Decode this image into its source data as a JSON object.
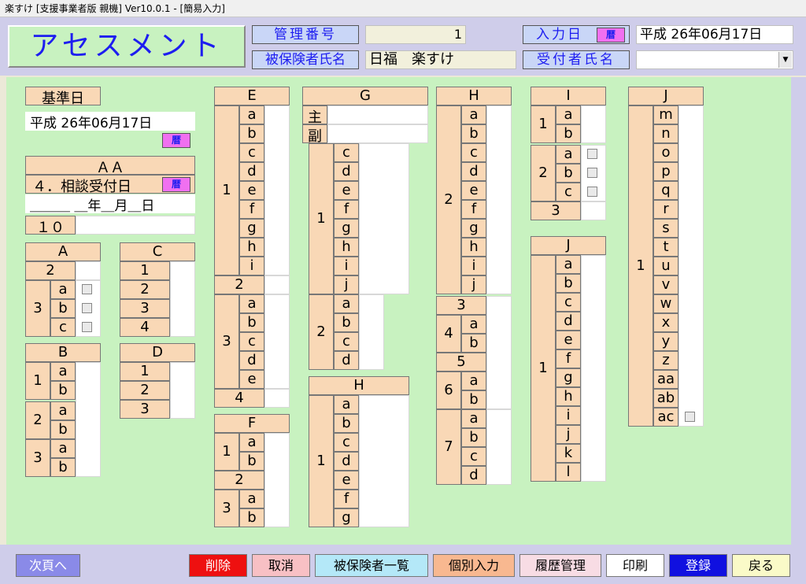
{
  "window": {
    "title": "楽すけ [支援事業者版 親機] Ver10.0.1 - [簡易入力]"
  },
  "header": {
    "logo": "アセスメント",
    "kanri_label": "管理番号",
    "kanri_value": "1",
    "nyuryoku_label": "入力日",
    "reki": "暦",
    "nyuryoku_date": "平成 26年06月17日",
    "hihoken_label": "被保険者氏名",
    "hihoken_value": "日福　楽すけ",
    "uketsuke_label": "受付者氏名",
    "uketsuke_value": ""
  },
  "left": {
    "kijun_label": "基準日",
    "kijun_date": "平成 26年06月17日",
    "aa_title": "ＡＡ",
    "soudan_label": "４．相談受付日",
    "soudan_date": "＿＿＿ ＿年＿月＿日",
    "code10": "１０"
  },
  "footer": {
    "next": "次頁へ",
    "delete": "削除",
    "cancel": "取消",
    "list": "被保険者一覧",
    "individual": "個別入力",
    "history": "履歴管理",
    "print": "印刷",
    "register": "登録",
    "back": "戻る"
  },
  "colors": {
    "peach": "#f9d8b6",
    "green": "#c8f2c0",
    "header": "#cfcdea",
    "blue": "#1d1df0"
  },
  "blocks": {
    "A": {
      "title": "A",
      "n2": "2",
      "n3": "3",
      "a": "a",
      "b": "b",
      "c": "c"
    },
    "B": {
      "title": "B",
      "n1": "1",
      "n2": "2",
      "n3": "3",
      "a": "a",
      "b": "b"
    },
    "C": {
      "title": "C",
      "r": [
        "1",
        "2",
        "3",
        "4"
      ]
    },
    "D": {
      "title": "D",
      "r": [
        "1",
        "2",
        "3"
      ]
    },
    "E": {
      "title": "E",
      "n1": "1",
      "n2": "2",
      "n3": "3",
      "n4": "4",
      "s1": [
        "a",
        "b",
        "c",
        "d",
        "e",
        "f",
        "g",
        "h",
        "i"
      ],
      "s3": [
        "a",
        "b",
        "c",
        "d",
        "e"
      ]
    },
    "F": {
      "title": "F",
      "n1": "1",
      "n2": "2",
      "n3": "3",
      "a": "a",
      "b": "b"
    },
    "G": {
      "title": "G",
      "main": "主",
      "sub": "副",
      "n1": "1",
      "n2": "2",
      "s1": [
        "c",
        "d",
        "e",
        "f",
        "g",
        "h",
        "i",
        "j"
      ],
      "s2": [
        "a",
        "b",
        "c",
        "d"
      ]
    },
    "H2": {
      "title": "H",
      "n1": "1",
      "s1": [
        "a",
        "b",
        "c",
        "d",
        "e",
        "f",
        "g"
      ]
    },
    "H": {
      "title": "H",
      "n2": "2",
      "n3": "3",
      "n4": "4",
      "n5": "5",
      "n6": "6",
      "n7": "7",
      "s2": [
        "a",
        "b",
        "c",
        "d",
        "e",
        "f",
        "g",
        "h",
        "i",
        "j"
      ],
      "ab": [
        "a",
        "b"
      ],
      "s7": [
        "a",
        "b",
        "c",
        "d"
      ]
    },
    "I": {
      "title": "I",
      "n1": "1",
      "n2": "2",
      "n3": "3",
      "s1": [
        "a",
        "b"
      ],
      "s2": [
        "a",
        "b",
        "c"
      ]
    },
    "J1": {
      "title": "J",
      "n1": "1",
      "s": [
        "a",
        "b",
        "c",
        "d",
        "e",
        "f",
        "g",
        "h",
        "i",
        "j",
        "k",
        "l"
      ]
    },
    "J2": {
      "title": "J",
      "n1": "1",
      "s": [
        "m",
        "n",
        "o",
        "p",
        "q",
        "r",
        "s",
        "t",
        "u",
        "v",
        "w",
        "x",
        "y",
        "z",
        "aa",
        "ab",
        "ac"
      ]
    }
  }
}
